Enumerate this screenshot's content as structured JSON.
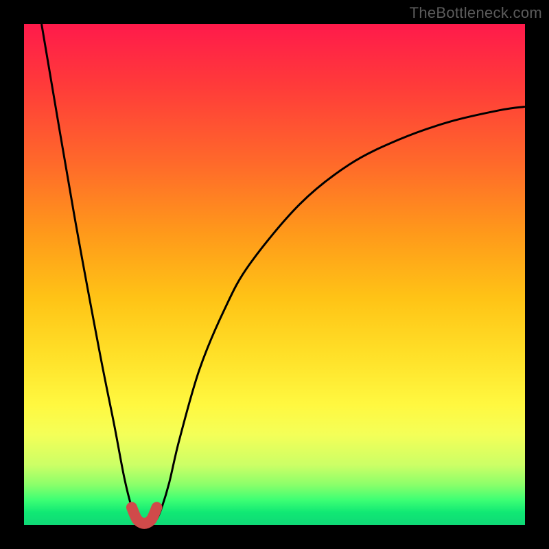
{
  "watermark": "TheBottleneck.com",
  "chart_data": {
    "type": "line",
    "title": "",
    "xlabel": "",
    "ylabel": "",
    "xlim": [
      0,
      1
    ],
    "ylim": [
      0,
      1
    ],
    "series": [
      {
        "name": "curve",
        "stroke": "#000000",
        "stroke_width": 3,
        "x": [
          0.035,
          0.1,
          0.15,
          0.18,
          0.2,
          0.215,
          0.225,
          0.235,
          0.24,
          0.245,
          0.255,
          0.265,
          0.275,
          0.29,
          0.31,
          0.35,
          0.4,
          0.45,
          0.55,
          0.65,
          0.75,
          0.85,
          0.95,
          1.0
        ],
        "y": [
          1.0,
          0.62,
          0.35,
          0.2,
          0.095,
          0.035,
          0.012,
          0.004,
          0.003,
          0.003,
          0.004,
          0.012,
          0.035,
          0.085,
          0.17,
          0.31,
          0.43,
          0.52,
          0.64,
          0.72,
          0.77,
          0.805,
          0.828,
          0.835
        ]
      },
      {
        "name": "bottom-marker",
        "stroke": "#d04a4a",
        "stroke_width": 16,
        "linecap": "round",
        "x": [
          0.215,
          0.225,
          0.235,
          0.245,
          0.255,
          0.265
        ],
        "y": [
          0.035,
          0.012,
          0.004,
          0.004,
          0.012,
          0.035
        ]
      }
    ]
  },
  "colors": {
    "background": "#000000",
    "watermark": "#5c5c5c",
    "curve": "#000000",
    "marker": "#d04a4a"
  }
}
